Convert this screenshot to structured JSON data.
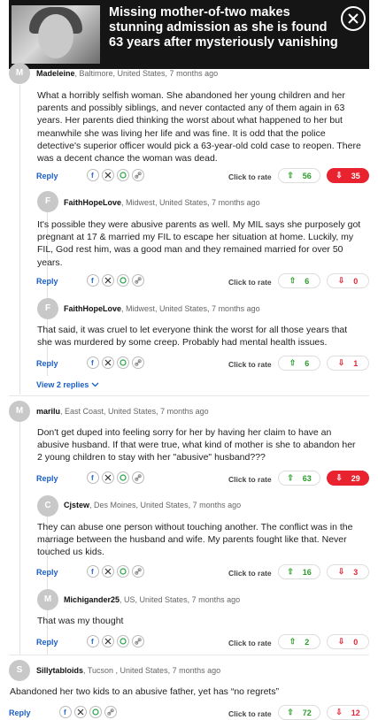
{
  "header": {
    "title": "Missing mother-of-two makes stunning admission as she is found 63 years after mysteriously vanishing"
  },
  "labels": {
    "reply": "Reply",
    "click_to_rate": "Click to rate",
    "view_replies": "View 2 replies"
  },
  "comments": [
    {
      "initial": "M",
      "user": "Madeleine",
      "location": ", Baltimore, United States, 7 months ago",
      "text": "What a horribly selfish woman. She abandoned her young children and her parents and possibly siblings, and never contacted any of them again in 63 years. Her parents died thinking the worst about what happened to her but meanwhile she was living her life and was fine. It is odd that the police detective's superior officer would pick a 63-year-old cold case to reopen. There was a decent chance the woman was dead.",
      "up": "56",
      "down": "35"
    },
    {
      "initial": "F",
      "user": "FaithHopeLove",
      "location": ", Midwest, United States, 7 months ago",
      "text": "It's possible they were abusive parents as well. My MIL says she purposely got pregnant at 17 & married my FIL to escape her situation at home. Luckily, my FIL, God rest him, was a good man and they remained married for over 50 years.",
      "up": "6",
      "down": "0"
    },
    {
      "initial": "F",
      "user": "FaithHopeLove",
      "location": ", Midwest, United States, 7 months ago",
      "text": "That said, it was cruel to let everyone think the worst for all those years that she was murdered by some creep. Probably had mental health issues.",
      "up": "6",
      "down": "1"
    },
    {
      "initial": "M",
      "user": "marilu",
      "location": ", East Coast, United States, 7 months ago",
      "text": "Don't get duped into feeling sorry for her by having her claim to have an abusive husband. If that were true, what kind of mother is she to abandon her 2 young children to stay with her \"abusive\" husband???",
      "up": "63",
      "down": "29"
    },
    {
      "initial": "C",
      "user": "Cjstew",
      "location": ", Des Moines, United States, 7 months ago",
      "text": "They can abuse one person without touching another. The conflict was in the marriage between the husband and wife. My parents fought like that. Never touched us kids.",
      "up": "16",
      "down": "3"
    },
    {
      "initial": "M",
      "user": "Michigander25",
      "location": ", US, United States, 7 months ago",
      "text": "That was my thought",
      "up": "2",
      "down": "0"
    },
    {
      "initial": "S",
      "user": "Sillytabloids",
      "location": ", Tucson , United States, 7 months ago",
      "text": "Abandoned her two kids to an abusive father, yet has “no regrets”",
      "up": "72",
      "down": "12"
    }
  ],
  "colors": {
    "accent": "#1a5fc7",
    "up": "#2a9d2a",
    "down": "#e32636",
    "header_bg": "#151515"
  }
}
